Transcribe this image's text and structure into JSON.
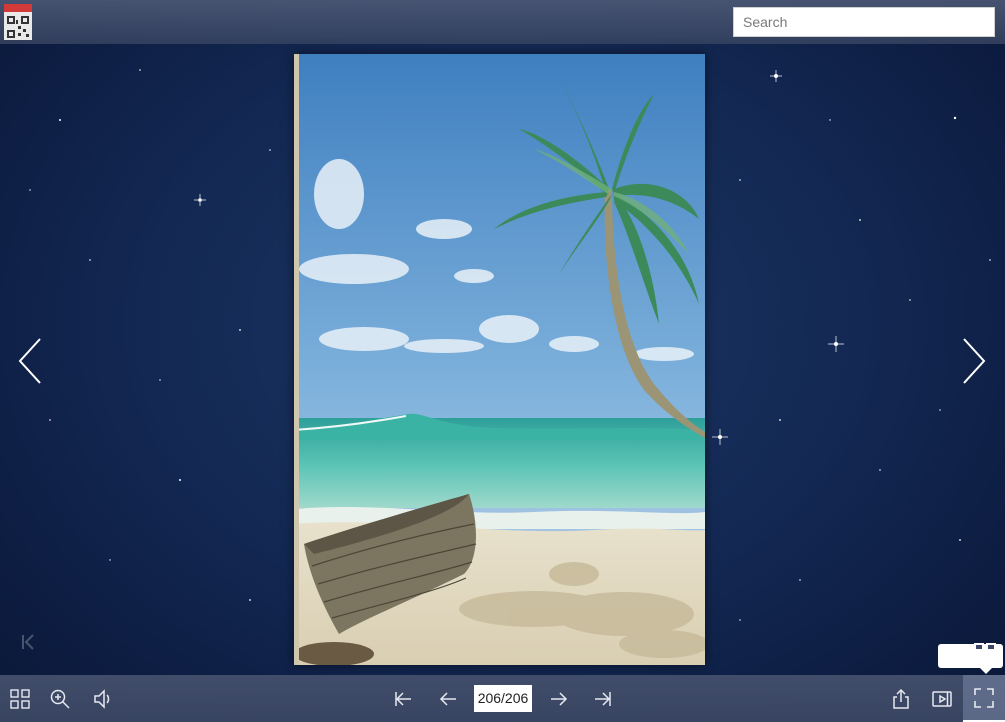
{
  "header": {
    "search": {
      "placeholder": "Search",
      "value": ""
    }
  },
  "navigation": {
    "prev_icon": "chevron-left-icon",
    "next_icon": "chevron-right-icon"
  },
  "toolbar": {
    "left": [
      "thumbnails-icon",
      "zoom-in-icon",
      "sound-icon"
    ],
    "center": [
      "first-page-icon",
      "previous-page-icon",
      "next-page-icon",
      "last-page-icon"
    ],
    "right": [
      "share-icon",
      "autoplay-icon",
      "fullscreen-icon"
    ],
    "page_indicator": "206/206"
  },
  "colors": {
    "background": "#142a55",
    "toolbar": "#4a5674",
    "icon": "#e6e9f0"
  }
}
